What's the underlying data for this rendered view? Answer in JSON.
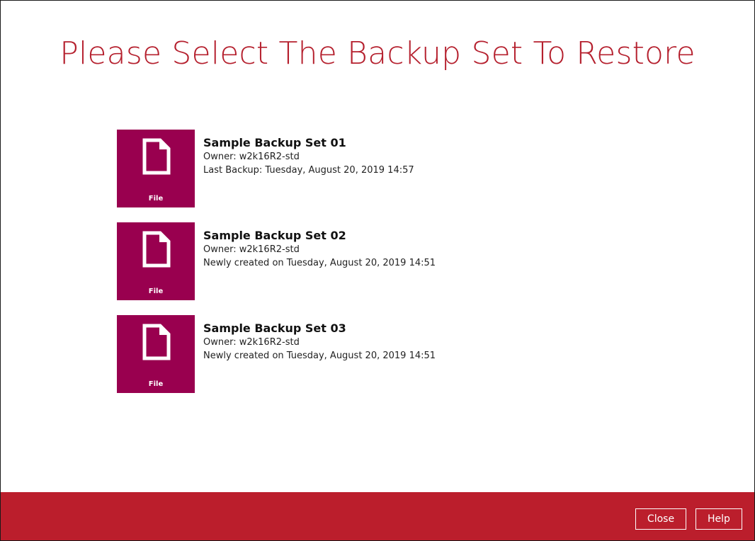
{
  "title": "Please Select The Backup Set To Restore",
  "backup_sets": [
    {
      "tile_label": "File",
      "icon": "file-icon",
      "name": "Sample Backup Set 01",
      "owner": "Owner: w2k16R2-std",
      "status": "Last Backup: Tuesday, August 20, 2019 14:57"
    },
    {
      "tile_label": "File",
      "icon": "file-icon",
      "name": "Sample Backup Set 02",
      "owner": "Owner: w2k16R2-std",
      "status": "Newly created on Tuesday, August 20, 2019 14:51"
    },
    {
      "tile_label": "File",
      "icon": "file-icon",
      "name": "Sample Backup Set 03",
      "owner": "Owner: w2k16R2-std",
      "status": "Newly created on Tuesday, August 20, 2019 14:51"
    }
  ],
  "footer": {
    "close_label": "Close",
    "help_label": "Help"
  },
  "colors": {
    "title": "#b5202e",
    "tile": "#99004f",
    "footer": "#bb1e2c"
  }
}
